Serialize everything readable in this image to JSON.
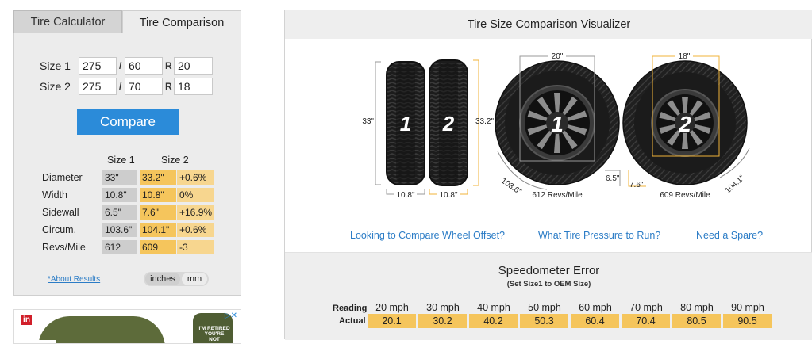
{
  "tabs": {
    "calculator": "Tire Calculator",
    "comparison": "Tire Comparison"
  },
  "size1": {
    "label": "Size 1",
    "width": "275",
    "aspect": "60",
    "rim": "20"
  },
  "size2": {
    "label": "Size 2",
    "width": "275",
    "aspect": "70",
    "rim": "18"
  },
  "separators": {
    "slash": "/",
    "rim_letter": "R"
  },
  "compare_button": "Compare",
  "results": {
    "headers": [
      "Size 1",
      "Size 2"
    ],
    "rows": [
      {
        "label": "Diameter",
        "s1": "33\"",
        "s2": "33.2\"",
        "diff": "+0.6%"
      },
      {
        "label": "Width",
        "s1": "10.8\"",
        "s2": "10.8\"",
        "diff": "0%"
      },
      {
        "label": "Sidewall",
        "s1": "6.5\"",
        "s2": "7.6\"",
        "diff": "+16.9%"
      },
      {
        "label": "Circum.",
        "s1": "103.6\"",
        "s2": "104.1\"",
        "diff": "+0.6%"
      },
      {
        "label": "Revs/Mile",
        "s1": "612",
        "s2": "609",
        "diff": "-3"
      }
    ]
  },
  "about_link": "*About Results",
  "units": {
    "inches": "inches",
    "mm": "mm",
    "selected": "inches"
  },
  "ad": {
    "badge": "in",
    "shirt_text": "I'M RETIRED YOU'RE NOT",
    "choices_icon": "ad-choices-icon"
  },
  "visualizer": {
    "title": "Tire Size Comparison Visualizer",
    "tread_view": {
      "tire1_number": "1",
      "tire2_number": "2",
      "height1": "33\"",
      "height2": "33.2\"",
      "width1": "10.8\"",
      "width2": "10.8\""
    },
    "side_view": {
      "tire1": {
        "number": "1",
        "rim": "20\"",
        "sidewall": "6.5\"",
        "circumference": "103.6\"",
        "revs": "612 Revs/Mile"
      },
      "tire2": {
        "number": "2",
        "rim": "18\"",
        "sidewall": "7.6\"",
        "circumference": "104.1\"",
        "revs": "609 Revs/Mile"
      }
    },
    "colors": {
      "accent": "#f5c55c",
      "link": "#2b7cc6",
      "button": "#2b8bd9"
    }
  },
  "links": [
    "Looking to Compare Wheel Offset?",
    "What Tire Pressure to Run?",
    "Need a Spare?"
  ],
  "speedometer": {
    "title": "Speedometer Error",
    "subtitle": "(Set Size1 to OEM Size)",
    "reading_label": "Reading",
    "actual_label": "Actual",
    "readings": [
      "20 mph",
      "30 mph",
      "40 mph",
      "50 mph",
      "60 mph",
      "70 mph",
      "80 mph",
      "90 mph"
    ],
    "actuals": [
      "20.1",
      "30.2",
      "40.2",
      "50.3",
      "60.4",
      "70.4",
      "80.5",
      "90.5"
    ]
  }
}
